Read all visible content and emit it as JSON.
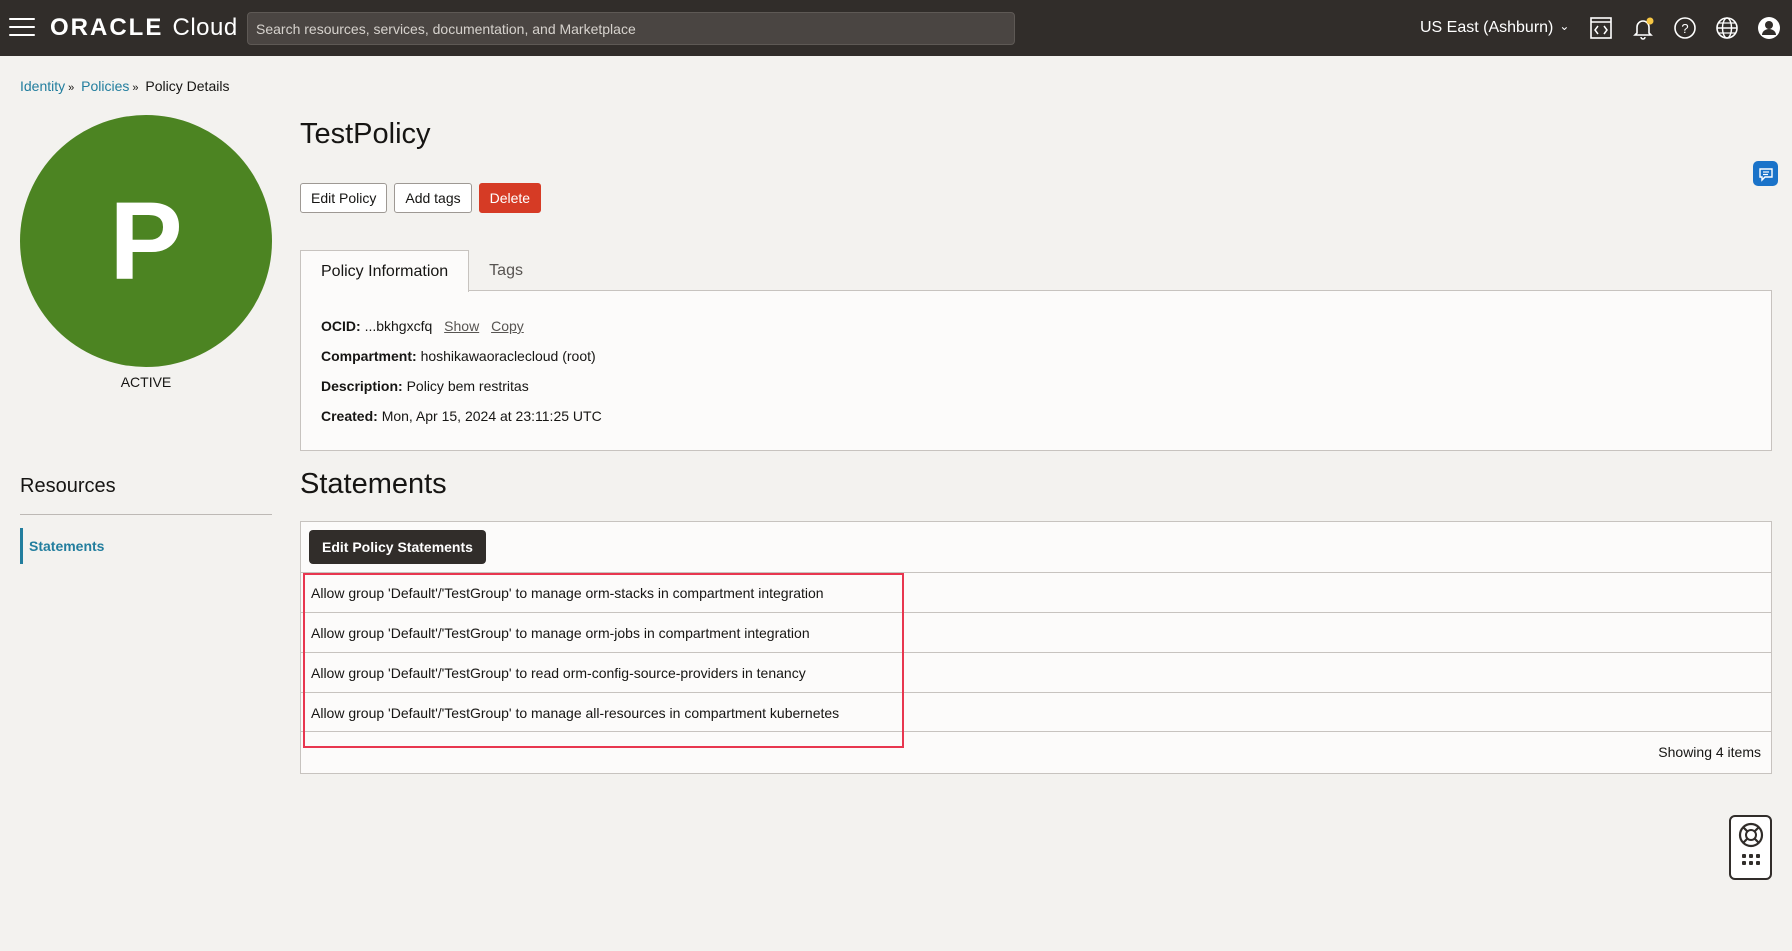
{
  "header": {
    "logo_brand": "ORACLE",
    "logo_product": "Cloud",
    "search_placeholder": "Search resources, services, documentation, and Marketplace",
    "region": "US East (Ashburn)",
    "icons": [
      "code-editor-icon",
      "notifications-bell-icon",
      "help-icon",
      "language-globe-icon",
      "profile-icon"
    ]
  },
  "breadcrumb": {
    "items": [
      "Identity",
      "Policies",
      "Policy Details"
    ]
  },
  "avatar": {
    "letter": "P",
    "status": "ACTIVE",
    "color": "#4c8422"
  },
  "resources": {
    "title": "Resources",
    "items": [
      "Statements"
    ]
  },
  "policy": {
    "title": "TestPolicy",
    "buttons": {
      "edit": "Edit Policy",
      "tags": "Add tags",
      "delete": "Delete"
    },
    "tabs": [
      "Policy Information",
      "Tags"
    ],
    "info": {
      "ocid_label": "OCID:",
      "ocid_value": "...bkhgxcfq",
      "show": "Show",
      "copy": "Copy",
      "compartment_label": "Compartment:",
      "compartment_value": "hoshikawaoraclecloud (root)",
      "description_label": "Description:",
      "description_value": "Policy bem restritas",
      "created_label": "Created:",
      "created_value": "Mon, Apr 15, 2024 at 23:11:25 UTC"
    }
  },
  "statements": {
    "title": "Statements",
    "edit_button": "Edit Policy Statements",
    "rows": [
      "Allow group 'Default'/'TestGroup' to manage orm-stacks in compartment integration",
      "Allow group 'Default'/'TestGroup' to manage orm-jobs in compartment integration",
      "Allow group 'Default'/'TestGroup' to read orm-config-source-providers in tenancy",
      "Allow group 'Default'/'TestGroup' to manage all-resources in compartment kubernetes"
    ],
    "showing": "Showing 4 items"
  },
  "colors": {
    "topbar": "#312d2a",
    "link": "#227e9e",
    "danger": "#d63b25",
    "highlight": "#e8364f"
  }
}
